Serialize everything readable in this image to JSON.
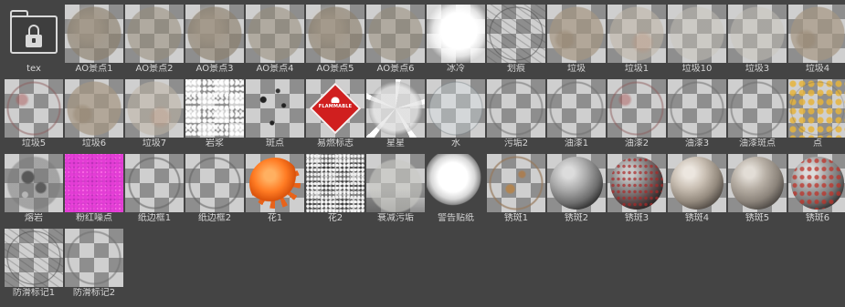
{
  "assets": [
    {
      "label": "tex",
      "look": "folder",
      "icon": "folder-lock-icon"
    },
    {
      "label": "AO景点1",
      "look": "ao"
    },
    {
      "label": "AO景点2",
      "look": "ao2"
    },
    {
      "label": "AO景点3",
      "look": "ao"
    },
    {
      "label": "AO景点4",
      "look": "ao2"
    },
    {
      "label": "AO景点5",
      "look": "ao"
    },
    {
      "label": "AO景点6",
      "look": "ao2"
    },
    {
      "label": "冰冷",
      "look": "frost"
    },
    {
      "label": "划痕",
      "look": "scratch"
    },
    {
      "label": "垃圾",
      "look": "dirt"
    },
    {
      "label": "垃圾1",
      "look": "dirt2"
    },
    {
      "label": "垃圾10",
      "look": "dirtlight"
    },
    {
      "label": "垃圾3",
      "look": "dirtlight"
    },
    {
      "label": "垃圾4",
      "look": "dirt"
    },
    {
      "label": "垃圾5",
      "look": "ringred"
    },
    {
      "label": "垃圾6",
      "look": "dirt"
    },
    {
      "label": "垃圾7",
      "look": "dirt2"
    },
    {
      "label": "岩浆",
      "look": "speckle"
    },
    {
      "label": "斑点",
      "look": "spots"
    },
    {
      "label": "易燃标志",
      "look": "diamond",
      "text": "FLAMMABLE"
    },
    {
      "label": "星星",
      "look": "star"
    },
    {
      "label": "水",
      "look": "water"
    },
    {
      "label": "污垢2",
      "look": "ring"
    },
    {
      "label": "油漆1",
      "look": "ring"
    },
    {
      "label": "油漆2",
      "look": "ringred"
    },
    {
      "label": "油漆3",
      "look": "ring"
    },
    {
      "label": "油漆斑点",
      "look": "ring"
    },
    {
      "label": "点",
      "look": "dots"
    },
    {
      "label": "熔岩",
      "look": "lava"
    },
    {
      "label": "粉红噪点",
      "look": "pink"
    },
    {
      "label": "纸边框1",
      "look": "frame"
    },
    {
      "label": "纸边框2",
      "look": "frame"
    },
    {
      "label": "花1",
      "look": "cog"
    },
    {
      "label": "花2",
      "look": "noise"
    },
    {
      "label": "衰减污垢",
      "look": "grime"
    },
    {
      "label": "警告贴纸",
      "look": "decal"
    },
    {
      "label": "锈斑1",
      "look": "rust1"
    },
    {
      "label": "锈斑2",
      "look": "s-rust2"
    },
    {
      "label": "锈斑3",
      "look": "s-rust3"
    },
    {
      "label": "锈斑4",
      "look": "s-rust4"
    },
    {
      "label": "锈斑5",
      "look": "s-rust5"
    },
    {
      "label": "锈斑6",
      "look": "s-rust6"
    },
    {
      "label": "防滑标记1",
      "look": "scratch"
    },
    {
      "label": "防滑标记2",
      "look": "ring"
    }
  ],
  "colors": {
    "background": "#444444",
    "label": "#d6d6d6",
    "checker_dark": "#8e8e8e",
    "checker_light": "#cfcfcf"
  }
}
